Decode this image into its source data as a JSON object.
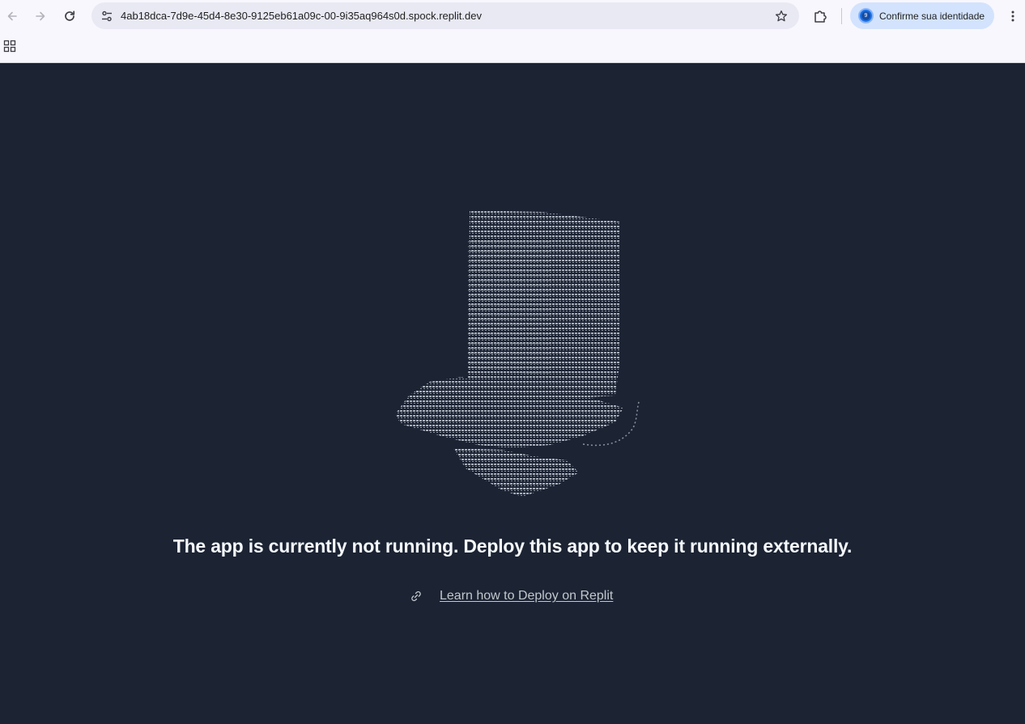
{
  "browser": {
    "url": "4ab18dca-7d9e-45d4-8e30-9125eb61a09c-00-9i35aq964s0d.spock.replit.dev",
    "profile_label": "Confirme sua identidade",
    "profile_avatar_text": "9",
    "icons": {
      "back": "arrow-left-icon",
      "forward": "arrow-right-icon",
      "reload": "reload-icon",
      "site_info": "tune-icon",
      "bookmark": "star-icon",
      "extensions": "puzzle-icon",
      "menu": "kebab-menu-icon",
      "apps": "apps-grid-icon"
    }
  },
  "page": {
    "illustration": "ascii-art-boot-illustration",
    "message": "The app is currently not running. Deploy this app to keep it running externally.",
    "link_label": "Learn how to Deploy on Replit",
    "link_icon": "link-icon"
  },
  "colors": {
    "page_background": "#1c2333",
    "message_text": "#f5f9fc",
    "link_text": "#c2c8cc",
    "art": "#aab0bb",
    "profile_chip": "#d3e3fd"
  }
}
